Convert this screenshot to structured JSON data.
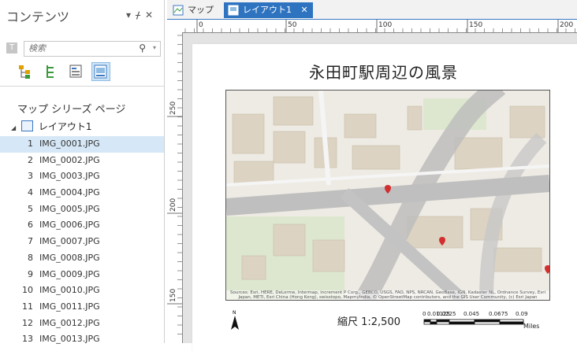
{
  "pane": {
    "title": "コンテンツ",
    "pin_glyph": "▾ ᚋ ✕",
    "search_placeholder": "検索",
    "section_label": "マップ シリーズ ページ",
    "layout_node": "レイアウト1",
    "pages": [
      {
        "num": "1",
        "name": "IMG_0001.JPG"
      },
      {
        "num": "2",
        "name": "IMG_0002.JPG"
      },
      {
        "num": "3",
        "name": "IMG_0003.JPG"
      },
      {
        "num": "4",
        "name": "IMG_0004.JPG"
      },
      {
        "num": "5",
        "name": "IMG_0005.JPG"
      },
      {
        "num": "6",
        "name": "IMG_0006.JPG"
      },
      {
        "num": "7",
        "name": "IMG_0007.JPG"
      },
      {
        "num": "8",
        "name": "IMG_0008.JPG"
      },
      {
        "num": "9",
        "name": "IMG_0009.JPG"
      },
      {
        "num": "10",
        "name": "IMG_0010.JPG"
      },
      {
        "num": "11",
        "name": "IMG_0011.JPG"
      },
      {
        "num": "12",
        "name": "IMG_0012.JPG"
      },
      {
        "num": "13",
        "name": "IMG_0013.JPG"
      }
    ],
    "selected_page": "1"
  },
  "tabs": {
    "map": "マップ",
    "layout": "レイアウト1",
    "close": "✕"
  },
  "ruler": {
    "top_labels": [
      "0",
      "50",
      "100",
      "150",
      "200"
    ],
    "left_labels": [
      "250",
      "200",
      "150"
    ]
  },
  "layout": {
    "title": "永田町駅周辺の風景",
    "north_label": "N",
    "scale_text": "縮尺 1:2,500",
    "scale_labels": [
      "0",
      "0.01125",
      "0.0225",
      "0.045",
      "0.0675",
      "0.09"
    ],
    "scale_unit": "Miles",
    "attribution": "Sources: Esri, HERE, DeLorme, Intermap, increment P Corp., GEBCO, USGS, FAO, NPS, NRCAN, GeoBase, IGN, Kadaster NL, Ordnance Survey, Esri Japan, METI, Esri China (Hong Kong), swisstopo, MapmyIndia, © OpenStreetMap contributors, and the GIS User Community, (c) Esri Japan"
  },
  "colors": {
    "accent": "#2e73c0",
    "selection": "#d6e8f7",
    "marker": "#d32f2f",
    "road": "#c4c4c4",
    "building": "#d9cfbd",
    "park": "#d7e4c4"
  }
}
